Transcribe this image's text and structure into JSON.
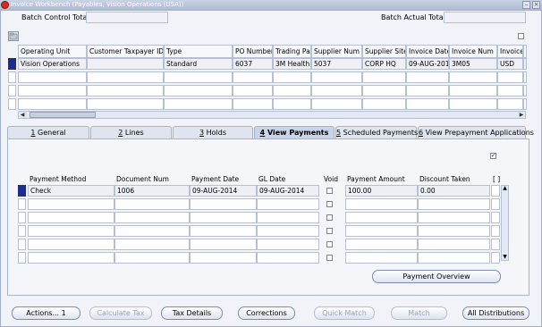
{
  "window": {
    "title": "Invoice Workbench (Payables, Vision Operations (USA))",
    "close": "×",
    "min": "–"
  },
  "header": {
    "batch_control_total_label": "Batch Control Total",
    "batch_control_total_value": "",
    "batch_actual_total_label": "Batch Actual Total",
    "batch_actual_total_value": ""
  },
  "invoices": {
    "columns": [
      "Operating Unit",
      "Customer Taxpayer ID",
      "Type",
      "PO Number",
      "Trading Pa",
      "Supplier Num",
      "Supplier Site",
      "Invoice Date",
      "Invoice Num",
      "Invoice",
      "I"
    ],
    "rows": [
      [
        "Vision Operations",
        "",
        "Standard",
        "6037",
        "3M Health",
        "5037",
        "CORP HQ",
        "09-AUG-201",
        "3M05",
        "USD",
        ""
      ],
      [
        "",
        "",
        "",
        "",
        "",
        "",
        "",
        "",
        "",
        "",
        ""
      ],
      [
        "",
        "",
        "",
        "",
        "",
        "",
        "",
        "",
        "",
        "",
        ""
      ],
      [
        "",
        "",
        "",
        "",
        "",
        "",
        "",
        "",
        "",
        "",
        ""
      ]
    ]
  },
  "tabs": [
    {
      "num": "1",
      "label": " General"
    },
    {
      "num": "2",
      "label": " Lines"
    },
    {
      "num": "3",
      "label": " Holds"
    },
    {
      "num": "4",
      "label": " View Payments"
    },
    {
      "num": "5",
      "label": " Scheduled Payments"
    },
    {
      "num": "6",
      "label": " View Prepayment Applications"
    }
  ],
  "payments": {
    "columns": [
      "Payment Method",
      "Document Num",
      "Payment Date",
      "GL Date",
      "Void",
      "Payment Amount",
      "Discount Taken",
      "[ ]"
    ],
    "rows": [
      [
        "Check",
        "1006",
        "09-AUG-2014",
        "09-AUG-2014",
        "",
        "100.00",
        "0.00"
      ],
      [
        "",
        "",
        "",
        "",
        "",
        "",
        ""
      ],
      [
        "",
        "",
        "",
        "",
        "",
        "",
        ""
      ],
      [
        "",
        "",
        "",
        "",
        "",
        "",
        ""
      ],
      [
        "",
        "",
        "",
        "",
        "",
        "",
        ""
      ],
      [
        "",
        "",
        "",
        "",
        "",
        "",
        ""
      ]
    ],
    "checked_mark": "✓"
  },
  "buttons": {
    "payment_overview": "Payment Overview",
    "actions": "Actions... 1",
    "calculate_tax": "Calculate Tax",
    "tax_details": "Tax Details",
    "corrections": "Corrections",
    "quick_match": "Quick Match",
    "match": "Match",
    "all_distributions": "All Distributions"
  }
}
